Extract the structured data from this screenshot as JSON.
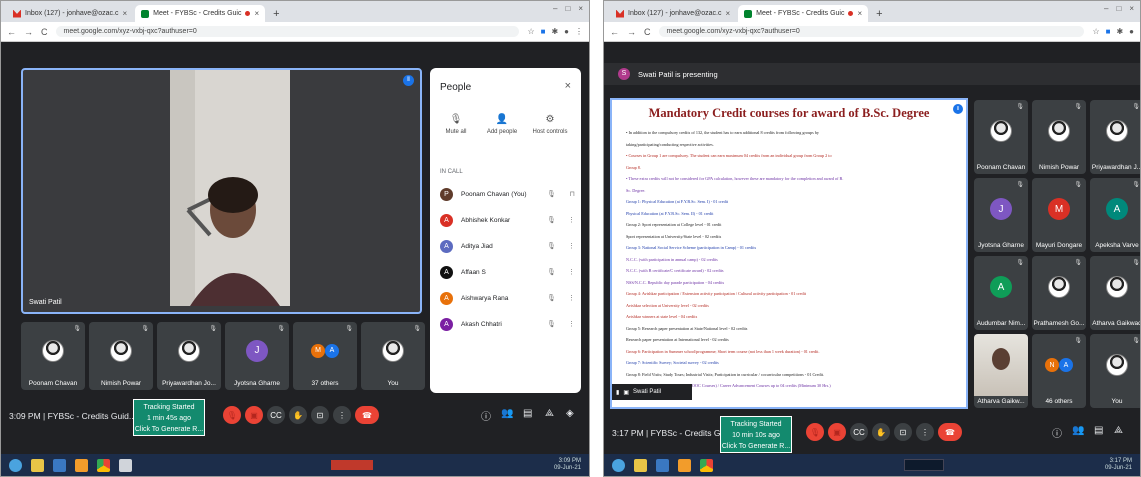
{
  "left": {
    "tabs": [
      {
        "label": "Inbox (127) - jonhave@ozac.c",
        "close": "×",
        "active": false,
        "icon": "gmail-icon"
      },
      {
        "label": "Meet - FYBSc - Credits Guic",
        "close": "×",
        "active": true,
        "icon": "meet-icon"
      }
    ],
    "new_tab": "+",
    "window_controls": [
      "–",
      "□",
      "×"
    ],
    "url": "meet.google.com/xyz-vxbj-qxc?authuser=0",
    "main_speaker": "Swati Patil",
    "people_panel": {
      "title": "People",
      "close": "×",
      "actions": [
        {
          "label": "Mute all",
          "icon": "mute-all-icon",
          "glyph": "🎙"
        },
        {
          "label": "Add people",
          "icon": "add-people-icon",
          "glyph": "👤"
        },
        {
          "label": "Host controls",
          "icon": "host-controls-icon",
          "glyph": "⚙"
        }
      ],
      "section": "IN CALL",
      "participants": [
        {
          "name": "Poonam Chavan (You)",
          "initial": "P",
          "color": "#5f3b2b"
        },
        {
          "name": "Abhishek Konkar",
          "initial": "A",
          "color": "#d93025"
        },
        {
          "name": "Aditya Jiad",
          "initial": "A",
          "color": "#5c6bc0"
        },
        {
          "name": "Affaan S",
          "initial": "A",
          "color": "#111111"
        },
        {
          "name": "Aishwarya Rana",
          "initial": "A",
          "color": "#e8710a"
        },
        {
          "name": "Akash Chhatri",
          "initial": "A",
          "color": "#7b1fa2"
        }
      ]
    },
    "tiles": [
      {
        "name": "Poonam Chavan",
        "type": "photo"
      },
      {
        "name": "Nimish Powar",
        "type": "photo"
      },
      {
        "name": "Priyawardhan Jo...",
        "type": "photo"
      },
      {
        "name": "Jyotsna Gharne",
        "type": "letter",
        "initial": "J",
        "color": "#7e57c2"
      },
      {
        "name": "37 others",
        "type": "others",
        "initials": [
          "M",
          "A"
        ]
      },
      {
        "name": "You",
        "type": "photo"
      }
    ],
    "bottom": {
      "time": "3:09 PM",
      "meeting": "FYBSc - Credits Guid...",
      "tracking": [
        "Tracking Started",
        "1 min 45s ago",
        "Click To Generate R..."
      ]
    },
    "tray": {
      "time": "3:09 PM",
      "date": "09-Jun-21"
    }
  },
  "right": {
    "tabs": [
      {
        "label": "Inbox (127) - jonhave@ozac.c",
        "close": "×",
        "active": false,
        "icon": "gmail-icon"
      },
      {
        "label": "Meet - FYBSc - Credits Guic",
        "close": "×",
        "active": true,
        "icon": "meet-icon"
      }
    ],
    "new_tab": "+",
    "window_controls": [
      "–",
      "□",
      "×"
    ],
    "url": "meet.google.com/xyz-vxbj-qxc?authuser=0",
    "presenting": "Swati Patil is presenting",
    "slide": {
      "title": "Mandatory Credit courses for award of B.Sc. Degree",
      "lines": [
        {
          "text": "•  In addition to the compulsory credits of 132, the student has to earn additional 8 credits from following groups by",
          "cls": "dark"
        },
        {
          "text": "    taking/participating/conducting respective activities.",
          "cls": "dark"
        },
        {
          "text": "•  Courses in Group 1 are compulsory. The student can earn maximum 04 credits from an individual group from Group 2 to",
          "cls": "red"
        },
        {
          "text": "    Group 8.",
          "cls": "red"
        },
        {
          "text": "•  These extra credits will not be considered for GPA calculation, however these are mandatory for the completion and award of B.",
          "cls": "purple"
        },
        {
          "text": "    Sc. Degree.",
          "cls": "purple"
        },
        {
          "text": "Group 1:  Physical Education (at F.Y.B.Sc. Sem. I) - 01 credit",
          "cls": "blue"
        },
        {
          "text": "               Physical Education (at F.Y.B.Sc. Sem. II) - 01 credit",
          "cls": "blue"
        },
        {
          "text": "Group 2:  Sport representation at College level - 01 credit",
          "cls": "dark"
        },
        {
          "text": "               Sport representation at University/State level - 02 credits",
          "cls": "dark"
        },
        {
          "text": "Group 3:  National Social Service Scheme (participation in Camp) - 01 credits",
          "cls": "blue"
        },
        {
          "text": "               N.C.C. (with participation in annual camp) - 02 credits",
          "cls": "purple"
        },
        {
          "text": "               N.C.C. (with B certificate/C certificate award) - 02 credits",
          "cls": "purple"
        },
        {
          "text": "               NSS/N.C.C. Republic day parade participation - 04 credits",
          "cls": "purple"
        },
        {
          "text": "Group 4:  Avishkar participation / Extension activity participation / Cultural activity participation - 01 credit",
          "cls": "red"
        },
        {
          "text": "               Avishkar selection at University level - 02 credits",
          "cls": "red"
        },
        {
          "text": "               Avishkar winners at state level - 04 credits",
          "cls": "red"
        },
        {
          "text": "Group 5:  Research paper presentation at State/National level - 02 credits",
          "cls": "dark"
        },
        {
          "text": "               Research paper presentation at International level - 02 credits",
          "cls": "dark"
        },
        {
          "text": "Group 6:  Participation in Summer school/programme; Short term course (not less than 1 week duration) - 01 credit.",
          "cls": "red"
        },
        {
          "text": "Group 7:  Scientific Survey; Societal survey - 02 credits",
          "cls": "blue"
        },
        {
          "text": "Group 8:  Field Visits; Study Tours; Industrial Visits; Participation in curricular / cocurricular competitions - 01 Credit.",
          "cls": "dark"
        },
        {
          "text": "Group 9:  Online certificate Courses (MOOC Courses) / Career Advancement Courses up to 04 credits (Minimum 30 Hrs.)",
          "cls": "purple"
        }
      ]
    },
    "tiles": [
      {
        "name": "Poonam Chavan",
        "type": "photo"
      },
      {
        "name": "Nimish Powar",
        "type": "photo"
      },
      {
        "name": "Priyawardhan J...",
        "type": "photo"
      },
      {
        "name": "Jyotsna Gharne",
        "type": "letter",
        "initial": "J",
        "color": "#7e57c2"
      },
      {
        "name": "Mayuri Dongare",
        "type": "letter",
        "initial": "M",
        "color": "#d93025"
      },
      {
        "name": "Apeksha Varve",
        "type": "letter",
        "initial": "A",
        "color": "#00897b"
      },
      {
        "name": "Audumbar Nim...",
        "type": "letter",
        "initial": "A",
        "color": "#0f9d58"
      },
      {
        "name": "Prathamesh Go...",
        "type": "photo"
      },
      {
        "name": "Atharva Gaikwad",
        "type": "photo"
      },
      {
        "name": "Atharva Gaikw...",
        "type": "video"
      },
      {
        "name": "46 others",
        "type": "others",
        "initials": [
          "N",
          "A"
        ]
      },
      {
        "name": "You",
        "type": "photo"
      }
    ],
    "presenter_strip": "Swati Patil",
    "bottom": {
      "time": "3:17 PM",
      "meeting": "FYBSc - Credits Guid...",
      "tracking": [
        "Tracking Started",
        "10 min 10s ago",
        "Click To Generate R..."
      ]
    },
    "tray": {
      "time": "3:17 PM",
      "date": "09-Jun-21"
    }
  }
}
